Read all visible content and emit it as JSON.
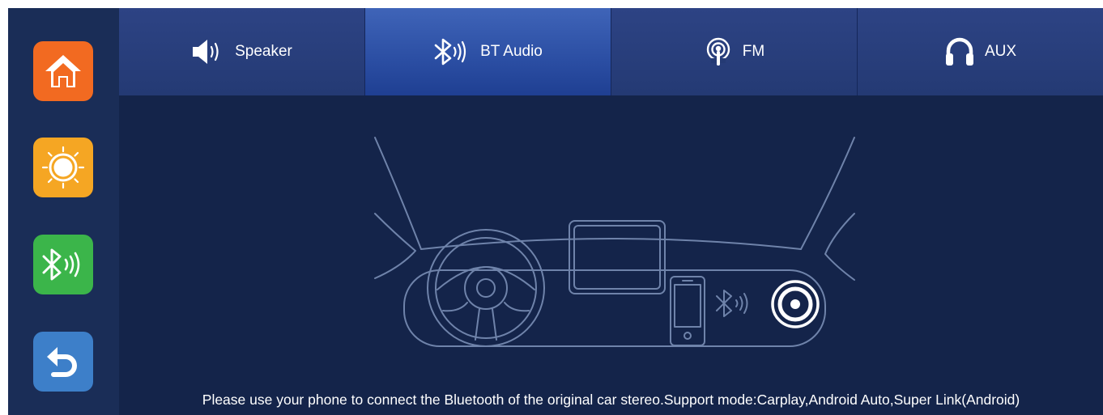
{
  "sidebar": {
    "buttons": [
      {
        "name": "home",
        "icon": "home-icon",
        "color": "#f26a21"
      },
      {
        "name": "brightness",
        "icon": "sun-icon",
        "color": "#f5a623"
      },
      {
        "name": "bluetooth",
        "icon": "bluetooth-icon",
        "color": "#3bb54a"
      },
      {
        "name": "back",
        "icon": "back-arrow-icon",
        "color": "#3d7fc9"
      }
    ]
  },
  "tabs": [
    {
      "label": "Speaker",
      "icon": "speaker-icon",
      "active": false
    },
    {
      "label": "BT Audio",
      "icon": "bluetooth-icon",
      "active": true
    },
    {
      "label": "FM",
      "icon": "fm-antenna-icon",
      "active": false
    },
    {
      "label": "AUX",
      "icon": "headphones-icon",
      "active": false
    }
  ],
  "main": {
    "caption": "Please use your phone to connect the Bluetooth of the original car stereo.Support mode:Carplay,Android Auto,Super Link(Android)"
  }
}
